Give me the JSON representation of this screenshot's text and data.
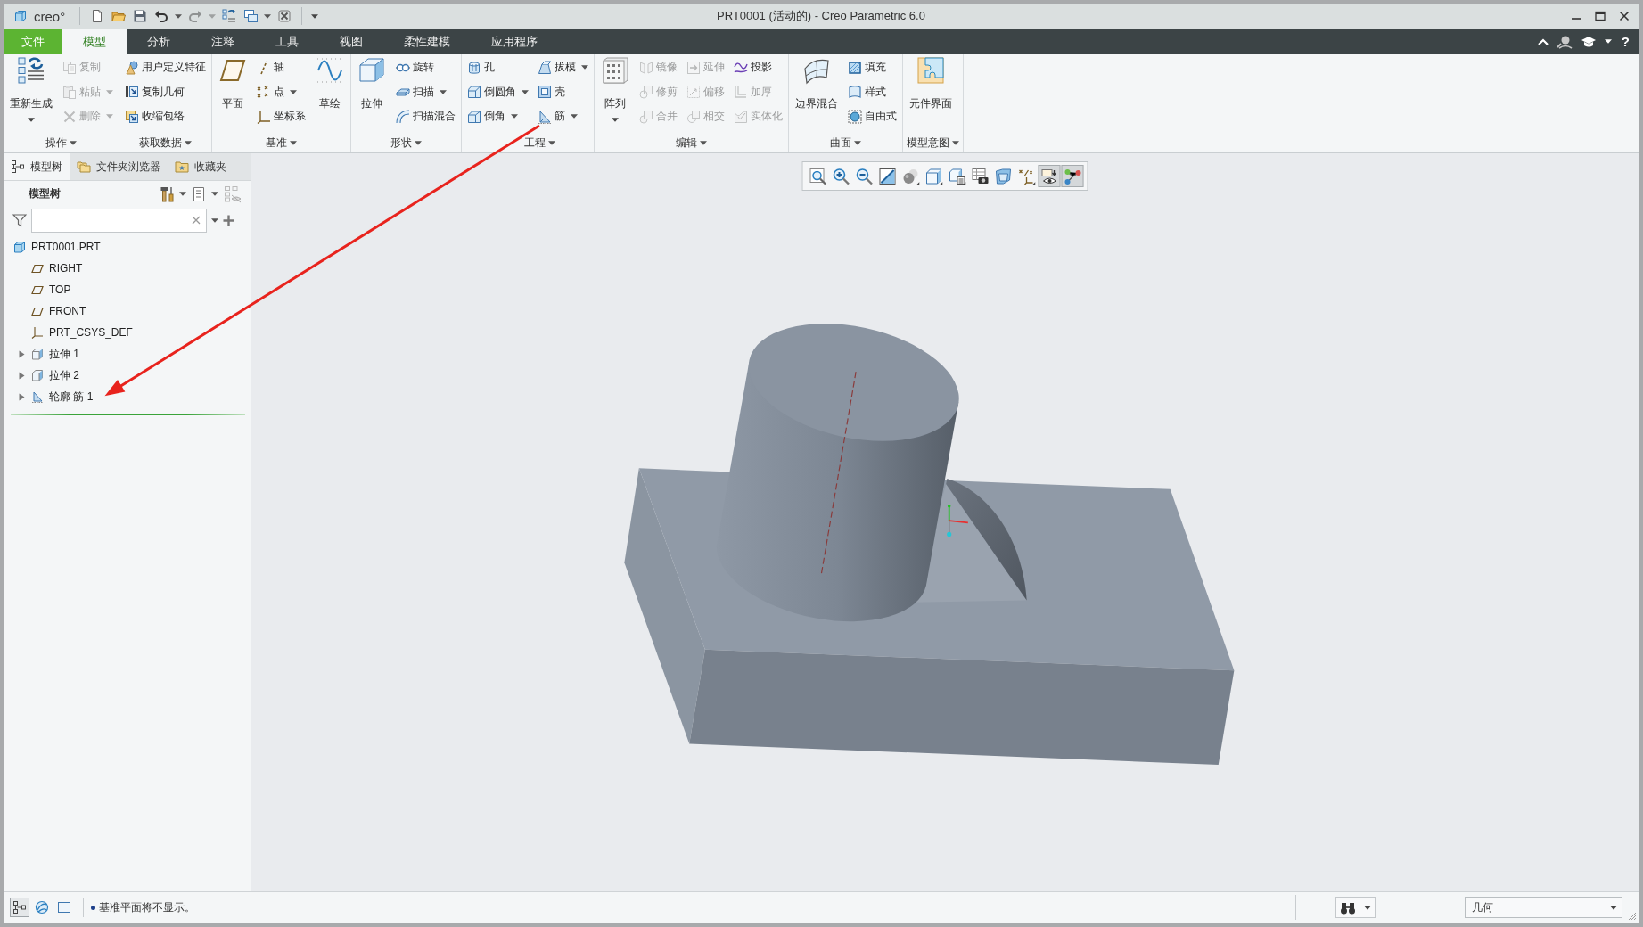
{
  "window": {
    "logo": "creo°",
    "title": "PRT0001 (活动的) - Creo Parametric 6.0"
  },
  "quick_access": [
    {
      "disabled": false,
      "dropdown": false
    },
    {
      "disabled": false,
      "dropdown": false
    },
    {
      "disabled": false,
      "dropdown": false
    },
    {
      "disabled": false,
      "dropdown": true
    },
    {
      "disabled": true,
      "dropdown": true
    },
    {
      "disabled": false,
      "dropdown": false
    },
    {
      "disabled": false,
      "dropdown": true
    },
    {
      "disabled": false,
      "dropdown": false
    }
  ],
  "menu_tabs": [
    {
      "label": "文件",
      "kind": "file",
      "selected": false
    },
    {
      "label": "模型",
      "kind": "tab",
      "selected": true
    },
    {
      "label": "分析",
      "kind": "tab",
      "selected": false
    },
    {
      "label": "注释",
      "kind": "tab",
      "selected": false
    },
    {
      "label": "工具",
      "kind": "tab",
      "selected": false
    },
    {
      "label": "视图",
      "kind": "tab",
      "selected": false
    },
    {
      "label": "柔性建模",
      "kind": "tab",
      "selected": false
    },
    {
      "label": "应用程序",
      "kind": "tab",
      "selected": false
    }
  ],
  "help": "?",
  "ribbon": {
    "groups": [
      {
        "title": "操作",
        "columns": [
          {
            "kind": "large",
            "label": "重新生成",
            "disabled": false,
            "dropdown": true
          },
          {
            "kind": "stack",
            "buttons": [
              {
                "label": "复制",
                "disabled": true,
                "dropdown": false
              },
              {
                "label": "粘贴",
                "disabled": true,
                "dropdown": true
              },
              {
                "label": "删除",
                "disabled": true,
                "dropdown": true
              }
            ]
          }
        ]
      },
      {
        "title": "获取数据",
        "columns": [
          {
            "kind": "stack",
            "buttons": [
              {
                "label": "用户定义特征",
                "disabled": false,
                "dropdown": false
              },
              {
                "label": "复制几何",
                "disabled": false,
                "dropdown": false
              },
              {
                "label": "收缩包络",
                "disabled": false,
                "dropdown": false
              }
            ]
          }
        ]
      },
      {
        "title": "基准",
        "columns": [
          {
            "kind": "large",
            "label": "平面",
            "disabled": false,
            "dropdown": false
          },
          {
            "kind": "stack",
            "buttons": [
              {
                "label": "轴",
                "disabled": false,
                "dropdown": false
              },
              {
                "label": "点",
                "disabled": false,
                "dropdown": true
              },
              {
                "label": "坐标系",
                "disabled": false,
                "dropdown": false
              }
            ]
          },
          {
            "kind": "large",
            "label": "草绘",
            "disabled": false,
            "dropdown": false
          }
        ]
      },
      {
        "title": "形状",
        "columns": [
          {
            "kind": "large",
            "label": "拉伸",
            "disabled": false,
            "dropdown": false
          },
          {
            "kind": "stack",
            "buttons": [
              {
                "label": "旋转",
                "disabled": false,
                "dropdown": false
              },
              {
                "label": "扫描",
                "disabled": false,
                "dropdown": true
              },
              {
                "label": "扫描混合",
                "disabled": false,
                "dropdown": false
              }
            ]
          }
        ]
      },
      {
        "title": "工程",
        "columns": [
          {
            "kind": "stack",
            "buttons": [
              {
                "label": "孔",
                "disabled": false,
                "dropdown": false
              },
              {
                "label": "倒圆角",
                "disabled": false,
                "dropdown": true
              },
              {
                "label": "倒角",
                "disabled": false,
                "dropdown": true
              }
            ]
          },
          {
            "kind": "stack",
            "buttons": [
              {
                "label": "拔模",
                "disabled": false,
                "dropdown": true
              },
              {
                "label": "壳",
                "disabled": false,
                "dropdown": false
              },
              {
                "label": "筋",
                "disabled": false,
                "dropdown": true
              }
            ]
          }
        ]
      },
      {
        "title": "编辑",
        "columns": [
          {
            "kind": "large",
            "label": "阵列",
            "disabled": false,
            "dropdown": true
          },
          {
            "kind": "stack",
            "buttons": [
              {
                "label": "镜像",
                "disabled": true,
                "dropdown": false
              },
              {
                "label": "修剪",
                "disabled": true,
                "dropdown": false
              },
              {
                "label": "合并",
                "disabled": true,
                "dropdown": false
              }
            ]
          },
          {
            "kind": "stack",
            "buttons": [
              {
                "label": "延伸",
                "disabled": true,
                "dropdown": false
              },
              {
                "label": "偏移",
                "disabled": true,
                "dropdown": false
              },
              {
                "label": "相交",
                "disabled": true,
                "dropdown": false
              }
            ]
          },
          {
            "kind": "stack",
            "buttons": [
              {
                "label": "投影",
                "disabled": false,
                "dropdown": false
              },
              {
                "label": "加厚",
                "disabled": true,
                "dropdown": false
              },
              {
                "label": "实体化",
                "disabled": true,
                "dropdown": false
              }
            ]
          }
        ]
      },
      {
        "title": "曲面",
        "columns": [
          {
            "kind": "large",
            "label": "边界混合",
            "disabled": false,
            "dropdown": false
          },
          {
            "kind": "stack",
            "buttons": [
              {
                "label": "填充",
                "disabled": false,
                "dropdown": false
              },
              {
                "label": "样式",
                "disabled": false,
                "dropdown": false
              },
              {
                "label": "自由式",
                "disabled": false,
                "dropdown": false
              }
            ]
          }
        ]
      },
      {
        "title": "模型意图",
        "columns": [
          {
            "kind": "large",
            "label": "元件界面",
            "disabled": false,
            "dropdown": false
          }
        ]
      }
    ]
  },
  "model_tree": {
    "tabs": [
      {
        "label": "模型树",
        "selected": true
      },
      {
        "label": "文件夹浏览器",
        "selected": false
      },
      {
        "label": "收藏夹",
        "selected": false
      }
    ],
    "title": "模型树",
    "items": [
      {
        "label": "PRT0001.PRT",
        "kind": "part",
        "children": [
          {
            "label": "RIGHT",
            "kind": "plane"
          },
          {
            "label": "TOP",
            "kind": "plane"
          },
          {
            "label": "FRONT",
            "kind": "plane"
          },
          {
            "label": "PRT_CSYS_DEF",
            "kind": "csys"
          },
          {
            "label": "拉伸 1",
            "kind": "extrude",
            "expanded": false
          },
          {
            "label": "拉伸 2",
            "kind": "extrude",
            "expanded": false
          },
          {
            "label": "轮廓 筋 1",
            "kind": "rib",
            "expanded": false
          }
        ]
      }
    ]
  },
  "view_toolbar": {
    "buttons": [
      {
        "on": false,
        "menu": false
      },
      {
        "on": false,
        "menu": false
      },
      {
        "on": false,
        "menu": false
      },
      {
        "on": false,
        "menu": false
      },
      {
        "on": false,
        "menu": true
      },
      {
        "on": false,
        "menu": true
      },
      {
        "on": false,
        "menu": true
      },
      {
        "on": false,
        "menu": false
      },
      {
        "on": false,
        "menu": false
      },
      {
        "on": false,
        "menu": true
      },
      {
        "on": true,
        "menu": false
      },
      {
        "on": true,
        "menu": false
      }
    ]
  },
  "status_bar": {
    "toggles": [
      {
        "on": true
      },
      {
        "on": false
      },
      {
        "on": false
      }
    ],
    "message": "基准平面将不显示。",
    "selection_filter": "几何"
  }
}
